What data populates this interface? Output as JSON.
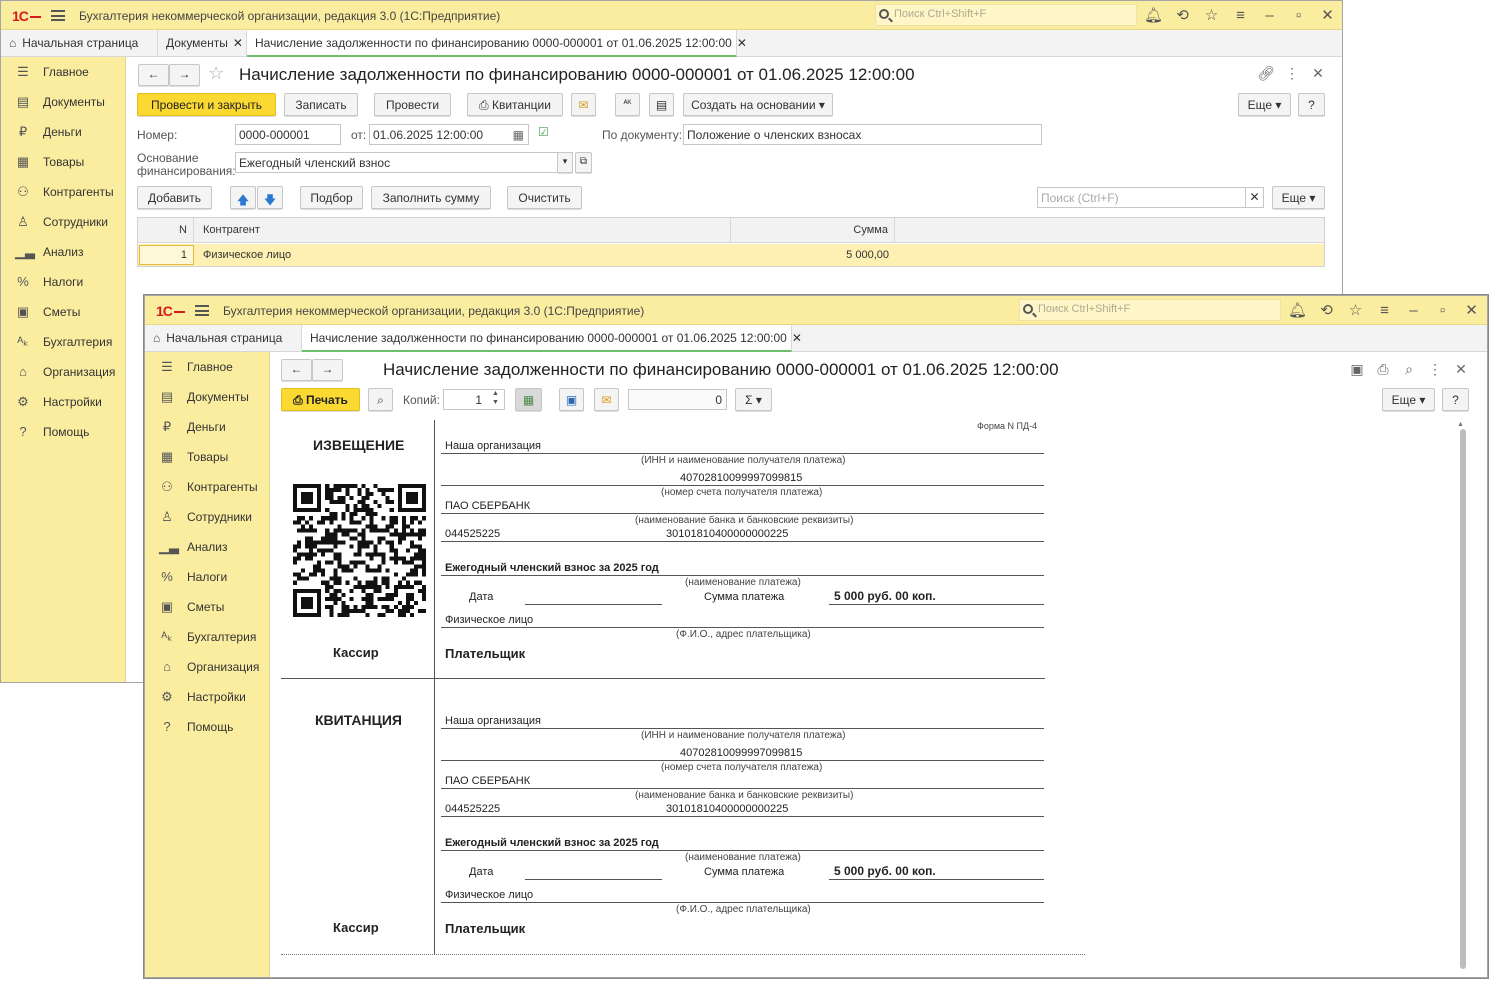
{
  "app": {
    "title": "Бухгалтерия некоммерческой организации, редакция 3.0  (1С:Предприятие)",
    "search_placeholder": "Поиск Ctrl+Shift+F",
    "logo": "1С"
  },
  "sidebar": [
    "Главное",
    "Документы",
    "Деньги",
    "Товары",
    "Контрагенты",
    "Сотрудники",
    "Анализ",
    "Налоги",
    "Сметы",
    "Бухгалтерия",
    "Организация",
    "Настройки",
    "Помощь"
  ],
  "w1": {
    "tabs": [
      "Начальная страница",
      "Документы",
      "Начисление задолженности по финансированию 0000-000001 от 01.06.2025 12:00:00"
    ],
    "title": "Начисление задолженности по финансированию 0000-000001 от 01.06.2025 12:00:00",
    "buttons": {
      "post_close": "Провести и закрыть",
      "save": "Записать",
      "post": "Провести",
      "receipts": "Квитанции",
      "create_based": "Создать на основании",
      "more": "Еще",
      "help": "?",
      "add": "Добавить",
      "pick": "Подбор",
      "fill_sum": "Заполнить сумму",
      "clear": "Очистить",
      "more2": "Еще"
    },
    "fields": {
      "number_label": "Номер:",
      "number": "0000-000001",
      "date_label": "от:",
      "date": "01.06.2025 12:00:00",
      "by_doc_label": "По документу:",
      "by_doc": "Положение о членских взносах",
      "basis_label_1": "Основание",
      "basis_label_2": "финансирования:",
      "basis": "Ежегодный членский взнос",
      "grid_search_placeholder": "Поиск (Ctrl+F)"
    },
    "grid": {
      "headers": [
        "N",
        "Контрагент",
        "Сумма"
      ],
      "rows": [
        [
          "1",
          "Физическое лицо",
          "5 000,00"
        ]
      ]
    }
  },
  "w2": {
    "tabs": [
      "Начальная страница",
      "Начисление задолженности по финансированию 0000-000001 от 01.06.2025 12:00:00"
    ],
    "title": "Начисление задолженности по финансированию 0000-000001 от 01.06.2025 12:00:00",
    "toolbar": {
      "print": "Печать",
      "copies_label": "Копий:",
      "copies": "1",
      "sum_value": "0",
      "more": "Еще",
      "help": "?"
    },
    "receipt": {
      "form_label": "Форма N ПД-4",
      "parts": [
        {
          "header": "ИЗВЕЩЕНИЕ",
          "cashier": "Кассир",
          "org": "Наша организация",
          "inn_caption": "(ИНН и наименование получателя платежа)",
          "account": "40702810099997099815",
          "account_caption": "(номер счета получателя платежа)",
          "bank": "ПАО СБЕРБАНК",
          "bank_caption": "(наименование банка и банковские реквизиты)",
          "bik": "044525225",
          "corr": "30101810400000000225",
          "payment": "Ежегодный членский взнос за 2025 год",
          "payment_caption": "(наименование платежа)",
          "date_label": "Дата",
          "sum_label": "Сумма платежа",
          "sum": "5 000 руб. 00 коп.",
          "payer": "Физическое лицо",
          "payer_caption": "(Ф.И.О., адрес плательщика)",
          "payer_sign": "Плательщик"
        },
        {
          "header": "КВИТАНЦИЯ",
          "cashier": "Кассир",
          "org": "Наша организация",
          "inn_caption": "(ИНН и наименование получателя платежа)",
          "account": "40702810099997099815",
          "account_caption": "(номер счета получателя платежа)",
          "bank": "ПАО СБЕРБАНК",
          "bank_caption": "(наименование банка и банковские реквизиты)",
          "bik": "044525225",
          "corr": "30101810400000000225",
          "payment": "Ежегодный членский взнос за 2025 год",
          "payment_caption": "(наименование платежа)",
          "date_label": "Дата",
          "sum_label": "Сумма платежа",
          "sum": "5 000 руб. 00 коп.",
          "payer": "Физическое лицо",
          "payer_caption": "(Ф.И.О., адрес плательщика)",
          "payer_sign": "Плательщик"
        }
      ]
    }
  }
}
